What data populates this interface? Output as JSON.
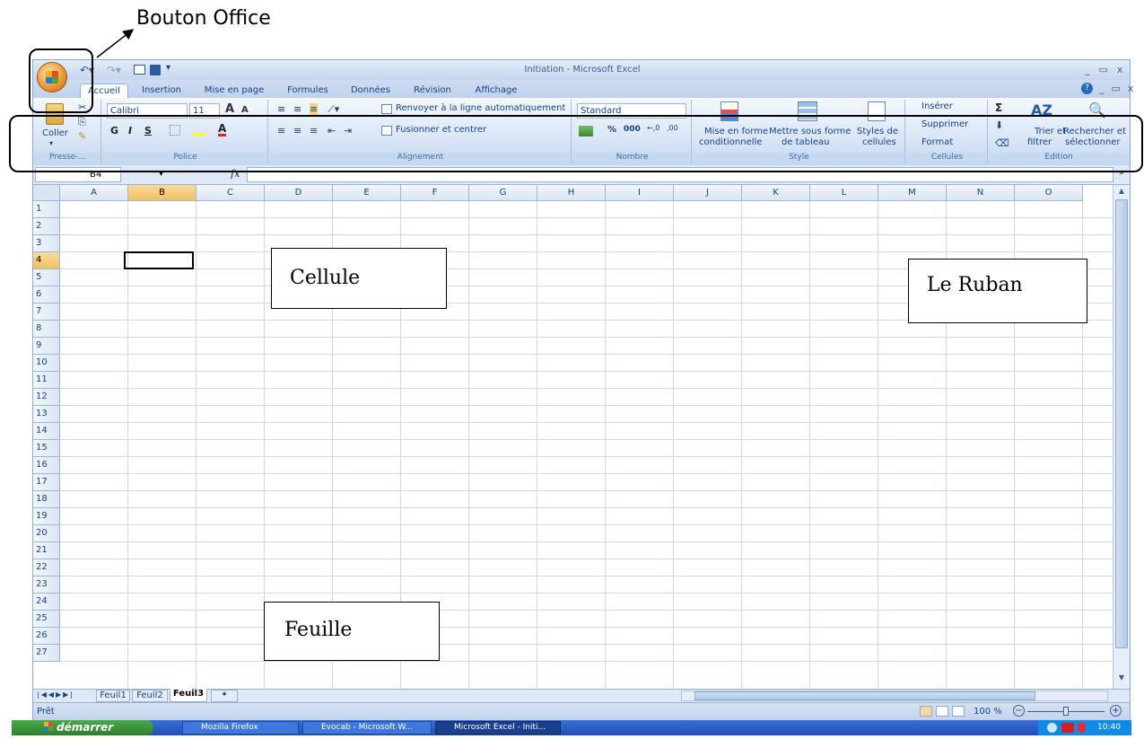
{
  "annotations": {
    "office_button": "Bouton Office",
    "cell": "Cellule",
    "ribbon": "Le Ruban",
    "sheet": "Feuille"
  },
  "window": {
    "title": "Initiation - Microsoft Excel"
  },
  "tabs": [
    "Accueil",
    "Insertion",
    "Mise en page",
    "Formules",
    "Données",
    "Révision",
    "Affichage"
  ],
  "ribbon": {
    "clipboard": {
      "paste": "Coller",
      "label": "Presse-..."
    },
    "font": {
      "name": "Calibri",
      "size": "11",
      "bold": "G",
      "italic": "I",
      "underline": "S",
      "label": "Police"
    },
    "alignment": {
      "wrap": "Renvoyer à la ligne automatiquement",
      "merge": "Fusionner et centrer",
      "label": "Alignement"
    },
    "number": {
      "format": "Standard",
      "percent": "%",
      "thousands": "000",
      "label": "Nombre"
    },
    "style": {
      "conditional": "Mise en forme",
      "conditional2": "conditionnelle",
      "table": "Mettre sous forme",
      "table2": "de tableau",
      "cellstyles": "Styles de",
      "cellstyles2": "cellules",
      "label": "Style"
    },
    "cells": {
      "insert": "Insérer",
      "delete": "Supprimer",
      "format": "Format",
      "label": "Cellules"
    },
    "editing": {
      "sort": "Trier et",
      "sort2": "filtrer",
      "find": "Rechercher et",
      "find2": "sélectionner",
      "label": "Édition"
    }
  },
  "namebox": "B4",
  "fx": "fx",
  "columns": [
    "A",
    "B",
    "C",
    "D",
    "E",
    "F",
    "G",
    "H",
    "I",
    "J",
    "K",
    "L",
    "M",
    "N",
    "O"
  ],
  "rows": [
    "1",
    "2",
    "3",
    "4",
    "5",
    "6",
    "7",
    "8",
    "9",
    "10",
    "11",
    "12",
    "13",
    "14",
    "15",
    "16",
    "17",
    "18",
    "19",
    "20",
    "21",
    "22",
    "23",
    "24",
    "25",
    "26",
    "27"
  ],
  "selected": {
    "column": "B",
    "row": "4"
  },
  "sheets": [
    "Feuil1",
    "Feuil2",
    "Feuil3"
  ],
  "active_sheet": "Feuil3",
  "status": {
    "ready": "Prêt",
    "zoom": "100 %"
  },
  "taskbar": {
    "start": "démarrer",
    "items": [
      "Mozilla Firefox",
      "Evocab - Microsoft W...",
      "Microsoft Excel - Initi..."
    ],
    "clock": "10:40"
  },
  "colors": {
    "selection": "#f1c15f",
    "ribbon": "#dfe8f6",
    "taskbar": "#245edb",
    "start": "#3c9a3c"
  }
}
